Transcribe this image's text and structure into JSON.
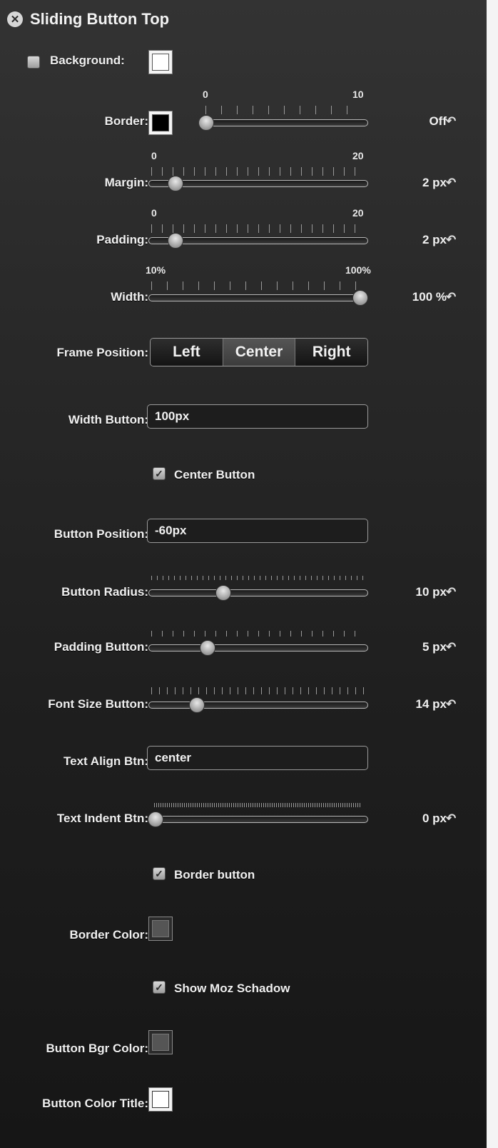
{
  "header": {
    "title": "Sliding Button Top",
    "close_icon": "close-icon"
  },
  "background": {
    "label": "Background:",
    "checked": false,
    "color": "#ffffff"
  },
  "border": {
    "label": "Border:",
    "color": "#000000",
    "min": "0",
    "max": "10",
    "value": "Off",
    "position": 0
  },
  "margin": {
    "label": "Margin:",
    "min": "0",
    "max": "20",
    "value": "2 px",
    "position": 0.1
  },
  "padding": {
    "label": "Padding:",
    "min": "0",
    "max": "20",
    "value": "2 px",
    "position": 0.1
  },
  "width": {
    "label": "Width:",
    "min": "10%",
    "max": "100%",
    "value": "100 %",
    "position": 1
  },
  "frame_position": {
    "label": "Frame Position:",
    "options": [
      "Left",
      "Center",
      "Right"
    ],
    "selected": "Center"
  },
  "width_button": {
    "label": "Width Button:",
    "value": "100px"
  },
  "center_button": {
    "label": "Center Button",
    "checked": true
  },
  "button_position": {
    "label": "Button Position:",
    "value": "-60px"
  },
  "button_radius": {
    "label": "Button Radius:",
    "value": "10 px",
    "position": 0.34
  },
  "padding_button": {
    "label": "Padding Button:",
    "value": "5 px",
    "position": 0.27
  },
  "font_size_button": {
    "label": "Font Size Button:",
    "value": "14 px",
    "position": 0.22
  },
  "text_align_btn": {
    "label": "Text Align Btn:",
    "value": "center"
  },
  "text_indent_btn": {
    "label": "Text Indent Btn:",
    "value": "0 px",
    "position": 0
  },
  "border_button": {
    "label": "Border button",
    "checked": true
  },
  "border_color": {
    "label": "Border Color:",
    "color": "#555555"
  },
  "show_moz_shadow": {
    "label": "Show Moz Schadow",
    "checked": true
  },
  "button_bgr_color": {
    "label": "Button Bgr Color:",
    "color": "#555555"
  },
  "button_color_title": {
    "label": "Button Color Title:",
    "color": "#ffffff"
  },
  "reset_icon": "undo-arrow-icon"
}
